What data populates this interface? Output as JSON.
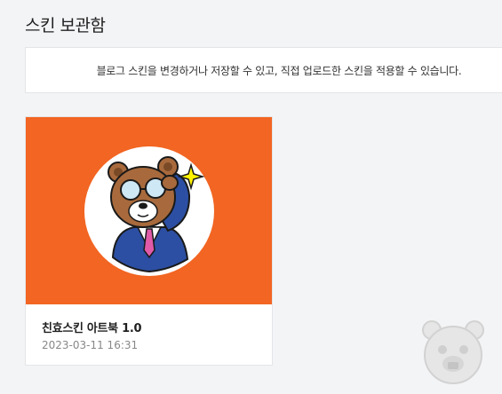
{
  "page": {
    "title": "스킨 보관함",
    "notice": "블로그 스킨을 변경하거나 저장할 수 있고, 직접 업로드한 스킨을 적용할 수 있습니다."
  },
  "skins": [
    {
      "name": "친효스킨 아트북 1.0",
      "date": "2023-03-11 16:31",
      "thumbnail_icon": "bear-with-glasses-icon",
      "thumbnail_bg": "#f26522"
    }
  ],
  "decor": {
    "mascot_icon": "bear-mascot-icon"
  }
}
